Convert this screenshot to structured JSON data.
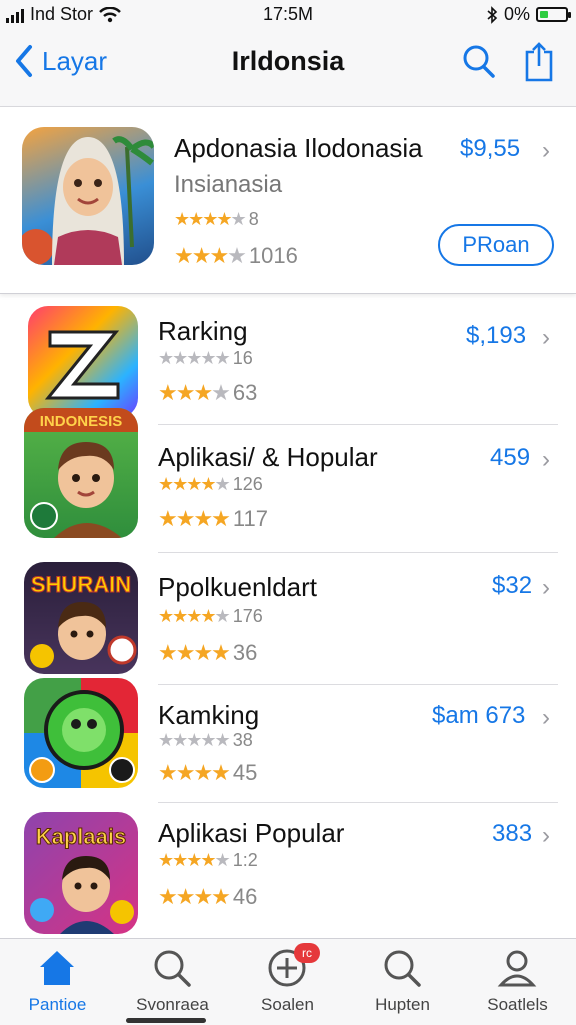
{
  "status_bar": {
    "carrier": "Ind Stor",
    "time": "17:5M",
    "battery": "0%"
  },
  "nav": {
    "back_label": "Layar",
    "title": "Irldonsia"
  },
  "featured": {
    "title": "Apdonasia Ilodonasia",
    "subtitle": "Insianasia",
    "price": "$9,55",
    "rating1": "8",
    "rating2": "1016",
    "button_label": "PRoan"
  },
  "rows": [
    {
      "title": "Rarking",
      "price": "$,193",
      "rating1": "16",
      "rating2": "63",
      "icon": "z-logo-icon"
    },
    {
      "title": "Aplikasi/ & Hopular",
      "price": "459",
      "rating1": "126",
      "rating2": "117",
      "icon": "boy-avatar-icon"
    },
    {
      "title": "Ppolkuenldart",
      "price": "$32",
      "rating1": "176",
      "rating2": "36",
      "icon": "shurain-game-icon"
    },
    {
      "title": "Kamking",
      "price": "$am 673",
      "rating1": "38",
      "rating2": "45",
      "icon": "green-chat-icon"
    },
    {
      "title": "Aplikasi  Popular",
      "price": "383",
      "rating1": "1:2",
      "rating2": "46",
      "icon": "kaplaais-game-icon"
    }
  ],
  "icon_banners": {
    "row2": "INDONESIS",
    "row3": "SHURAIN",
    "row5": "Kaplaais"
  },
  "tabs": [
    {
      "label": "Pantioe",
      "icon": "home-icon"
    },
    {
      "label": "Svonraea",
      "icon": "search-icon"
    },
    {
      "label": "Soalen",
      "icon": "add-circle-icon",
      "badge": "rc"
    },
    {
      "label": "Hupten",
      "icon": "search-icon"
    },
    {
      "label": "Soatlels",
      "icon": "person-icon"
    }
  ],
  "colors": {
    "accent": "#1677e6",
    "star": "#f5a623",
    "badge": "#e5383b"
  }
}
